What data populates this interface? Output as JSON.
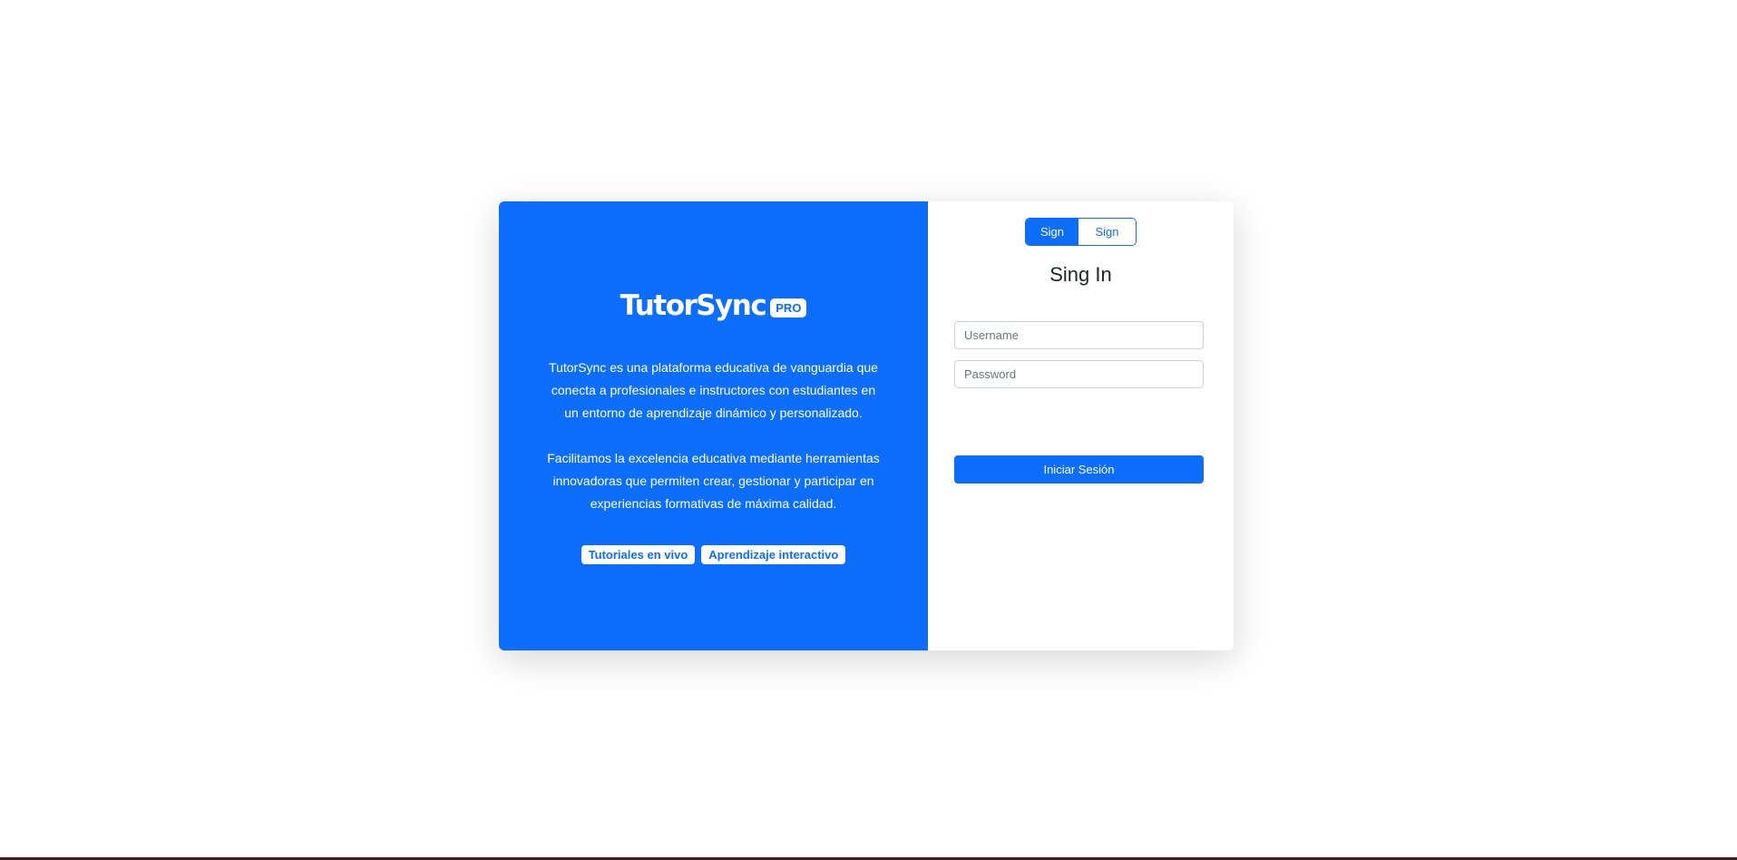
{
  "brand": {
    "name": "TutorSync",
    "badge": "PRO"
  },
  "description": {
    "paragraph_1": "TutorSync es una plataforma educativa de vanguardia que conecta a profesionales e instructores con estudiantes en un entorno de aprendizaje dinámico y personalizado.",
    "paragraph_2": "Facilitamos la excelencia educativa mediante herramientas innovadoras que permiten crear, gestionar y participar en experiencias formativas de máxima calidad."
  },
  "tags": [
    "Tutoriales en vivo",
    "Aprendizaje interactivo"
  ],
  "auth_toggle": {
    "sign_in": "Sign In",
    "sign_up": "Sign Up",
    "active": "sign_in"
  },
  "form": {
    "title": "Sing In",
    "username": {
      "placeholder": "Username",
      "value": ""
    },
    "password": {
      "placeholder": "Password",
      "value": ""
    },
    "submit_label": "Iniciar Sesión"
  },
  "colors": {
    "primary": "#0d6efd",
    "background": "#ffffff",
    "bottom_border": "#4a1a26"
  }
}
